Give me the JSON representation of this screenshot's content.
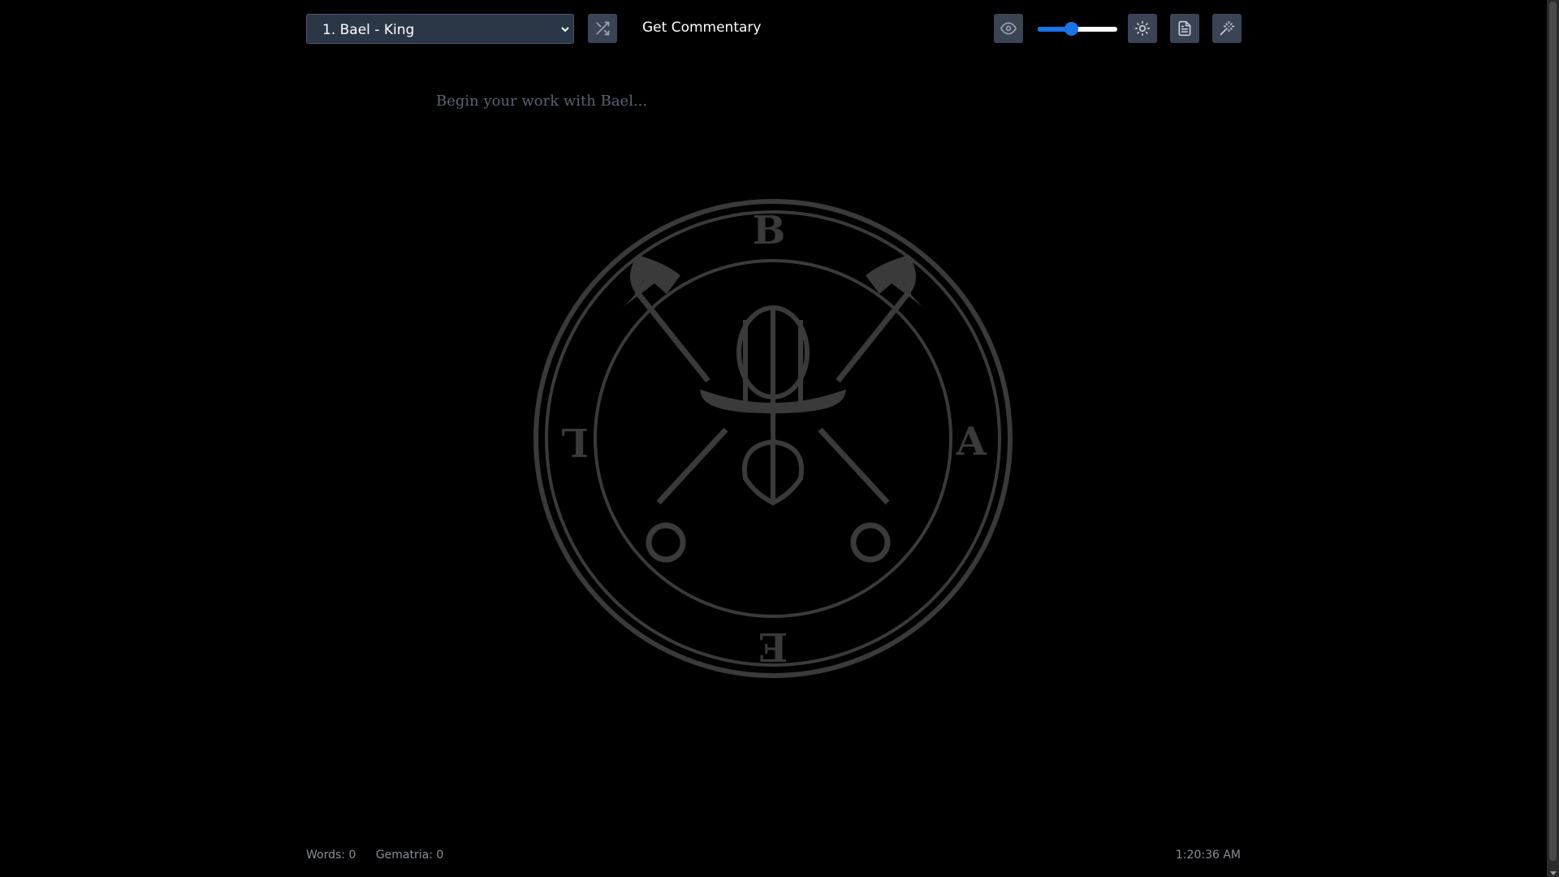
{
  "toolbar": {
    "spirit_select": {
      "selected": "1. Bael - King"
    },
    "shuffle_icon": "shuffle-icon",
    "commentary_label": "Get Commentary",
    "eye_icon": "eye-icon",
    "opacity_slider": {
      "value_fraction": 0.42
    },
    "theme_icon": "sun-icon",
    "document_icon": "document-icon",
    "magic_icon": "wand-icon"
  },
  "editor": {
    "placeholder": "Begin your work with Bael..."
  },
  "sigil": {
    "letters": [
      "B",
      "A",
      "E",
      "L"
    ]
  },
  "status": {
    "words": "Words: 0",
    "gematria": "Gematria: 0",
    "time": "1:20:36 AM"
  },
  "colors": {
    "background": "#000000",
    "button_bg": "#3b4454",
    "select_bg": "#2b3647",
    "slider_accent": "#1a73e8",
    "sigil_stroke": "#3a3a3a"
  }
}
